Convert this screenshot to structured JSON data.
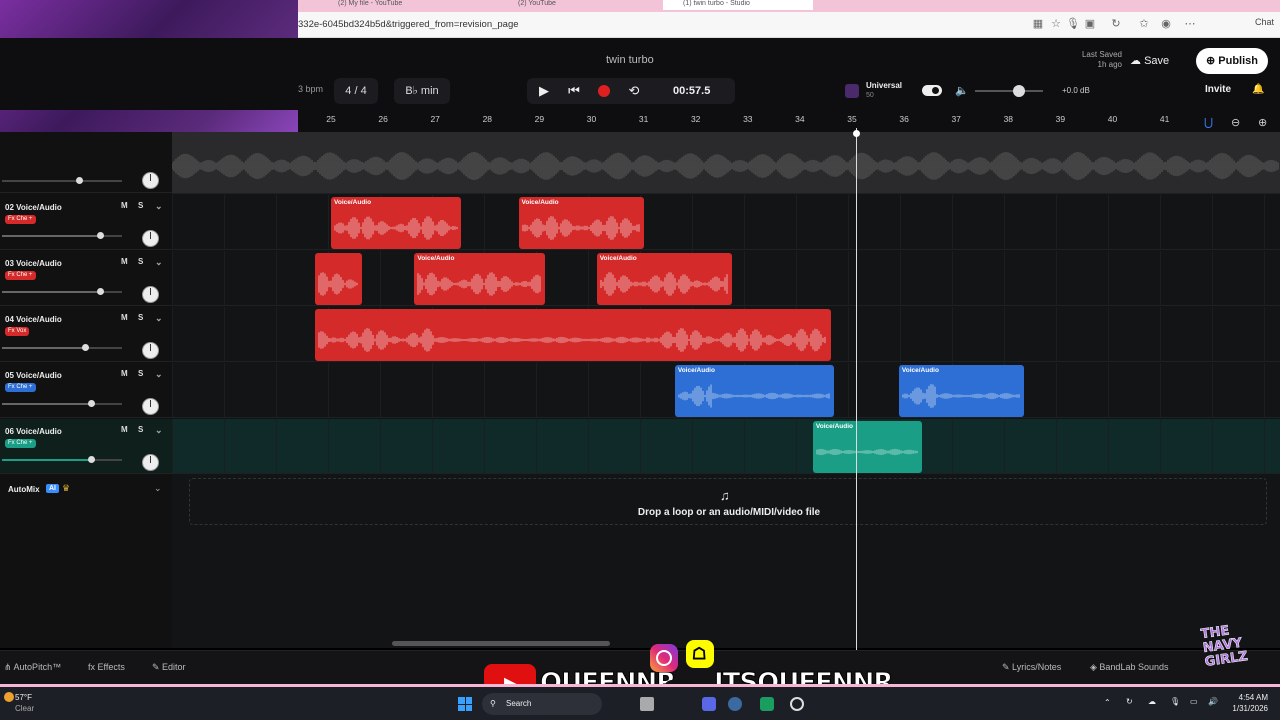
{
  "browser": {
    "tabs": [
      "(2) My file - YouTube",
      "(2) YouTube",
      "(1) twin turbo - Studio"
    ],
    "url": "332e-6045bd324b5d&triggered_from=revision_page",
    "chat_label": "Chat"
  },
  "header": {
    "project_title": "twin turbo",
    "bpm_label": "3 bpm",
    "time_signature": "4 / 4",
    "key": "B♭ min",
    "time": "00:57.5",
    "instrument_name": "Universal",
    "instrument_sub": "50",
    "volume_db": "+0.0 dB",
    "last_saved": "Last Saved",
    "last_saved_time": "1h ago",
    "save_label": "Save",
    "publish_label": "Publish",
    "invite_label": "Invite"
  },
  "ruler": {
    "ticks": [
      "25",
      "26",
      "27",
      "28",
      "29",
      "30",
      "31",
      "32",
      "33",
      "34",
      "35",
      "36",
      "37",
      "38",
      "39",
      "40",
      "41"
    ]
  },
  "tracks": [
    {
      "name": "02 Voice/Audio",
      "fx": "Fx Che +",
      "color": "#d42a2a",
      "clips": [
        {
          "label": "Voice/Audio",
          "start": 25.0,
          "end": 27.5
        },
        {
          "label": "Voice/Audio",
          "start": 28.6,
          "end": 31.0
        }
      ]
    },
    {
      "name": "03 Voice/Audio",
      "fx": "Fx Che +",
      "color": "#d42a2a",
      "clips": [
        {
          "label": "",
          "start": 24.7,
          "end": 25.6
        },
        {
          "label": "Voice/Audio",
          "start": 26.6,
          "end": 29.1
        },
        {
          "label": "Voice/Audio",
          "start": 30.1,
          "end": 32.7
        }
      ]
    },
    {
      "name": "04 Voice/Audio",
      "fx": "Fx Vox",
      "color": "#d42a2a",
      "clips": [
        {
          "label": "",
          "start": 24.7,
          "end": 34.6
        }
      ]
    },
    {
      "name": "05 Voice/Audio",
      "fx": "Fx Che +",
      "color": "#2d6fd4",
      "clips": [
        {
          "label": "Voice/Audio",
          "start": 31.6,
          "end": 34.65
        },
        {
          "label": "Voice/Audio",
          "start": 35.9,
          "end": 38.3
        }
      ]
    },
    {
      "name": "06 Voice/Audio",
      "fx": "Fx Che +",
      "color": "#1a9e86",
      "clips": [
        {
          "label": "Voice/Audio",
          "start": 34.25,
          "end": 36.35
        }
      ]
    }
  ],
  "track_controls": {
    "mute": "M",
    "solo": "S"
  },
  "automix": {
    "label": "AutoMix",
    "badge": "AI"
  },
  "dropzone": {
    "text": "Drop a loop or an audio/MIDI/video file"
  },
  "bottom": {
    "autopitch": "AutoPitch™",
    "effects": "Effects",
    "editor": "Editor",
    "lyrics": "Lyrics/Notes",
    "sounds": "BandLab Sounds"
  },
  "overlay": {
    "left_handle": "QUEENNR",
    "right_handle": "ITSQUEENNR",
    "logo_text": "THE NAVY GIRLZ"
  },
  "taskbar": {
    "weather_temp": "57°F",
    "weather_desc": "Clear",
    "search": "Search",
    "time": "4:54 AM",
    "date": "1/31/2026"
  },
  "colors": {
    "red_clip": "#d42a2a",
    "blue_clip": "#2d6fd4",
    "teal_clip": "#1a9e86",
    "record": "#e02020"
  }
}
